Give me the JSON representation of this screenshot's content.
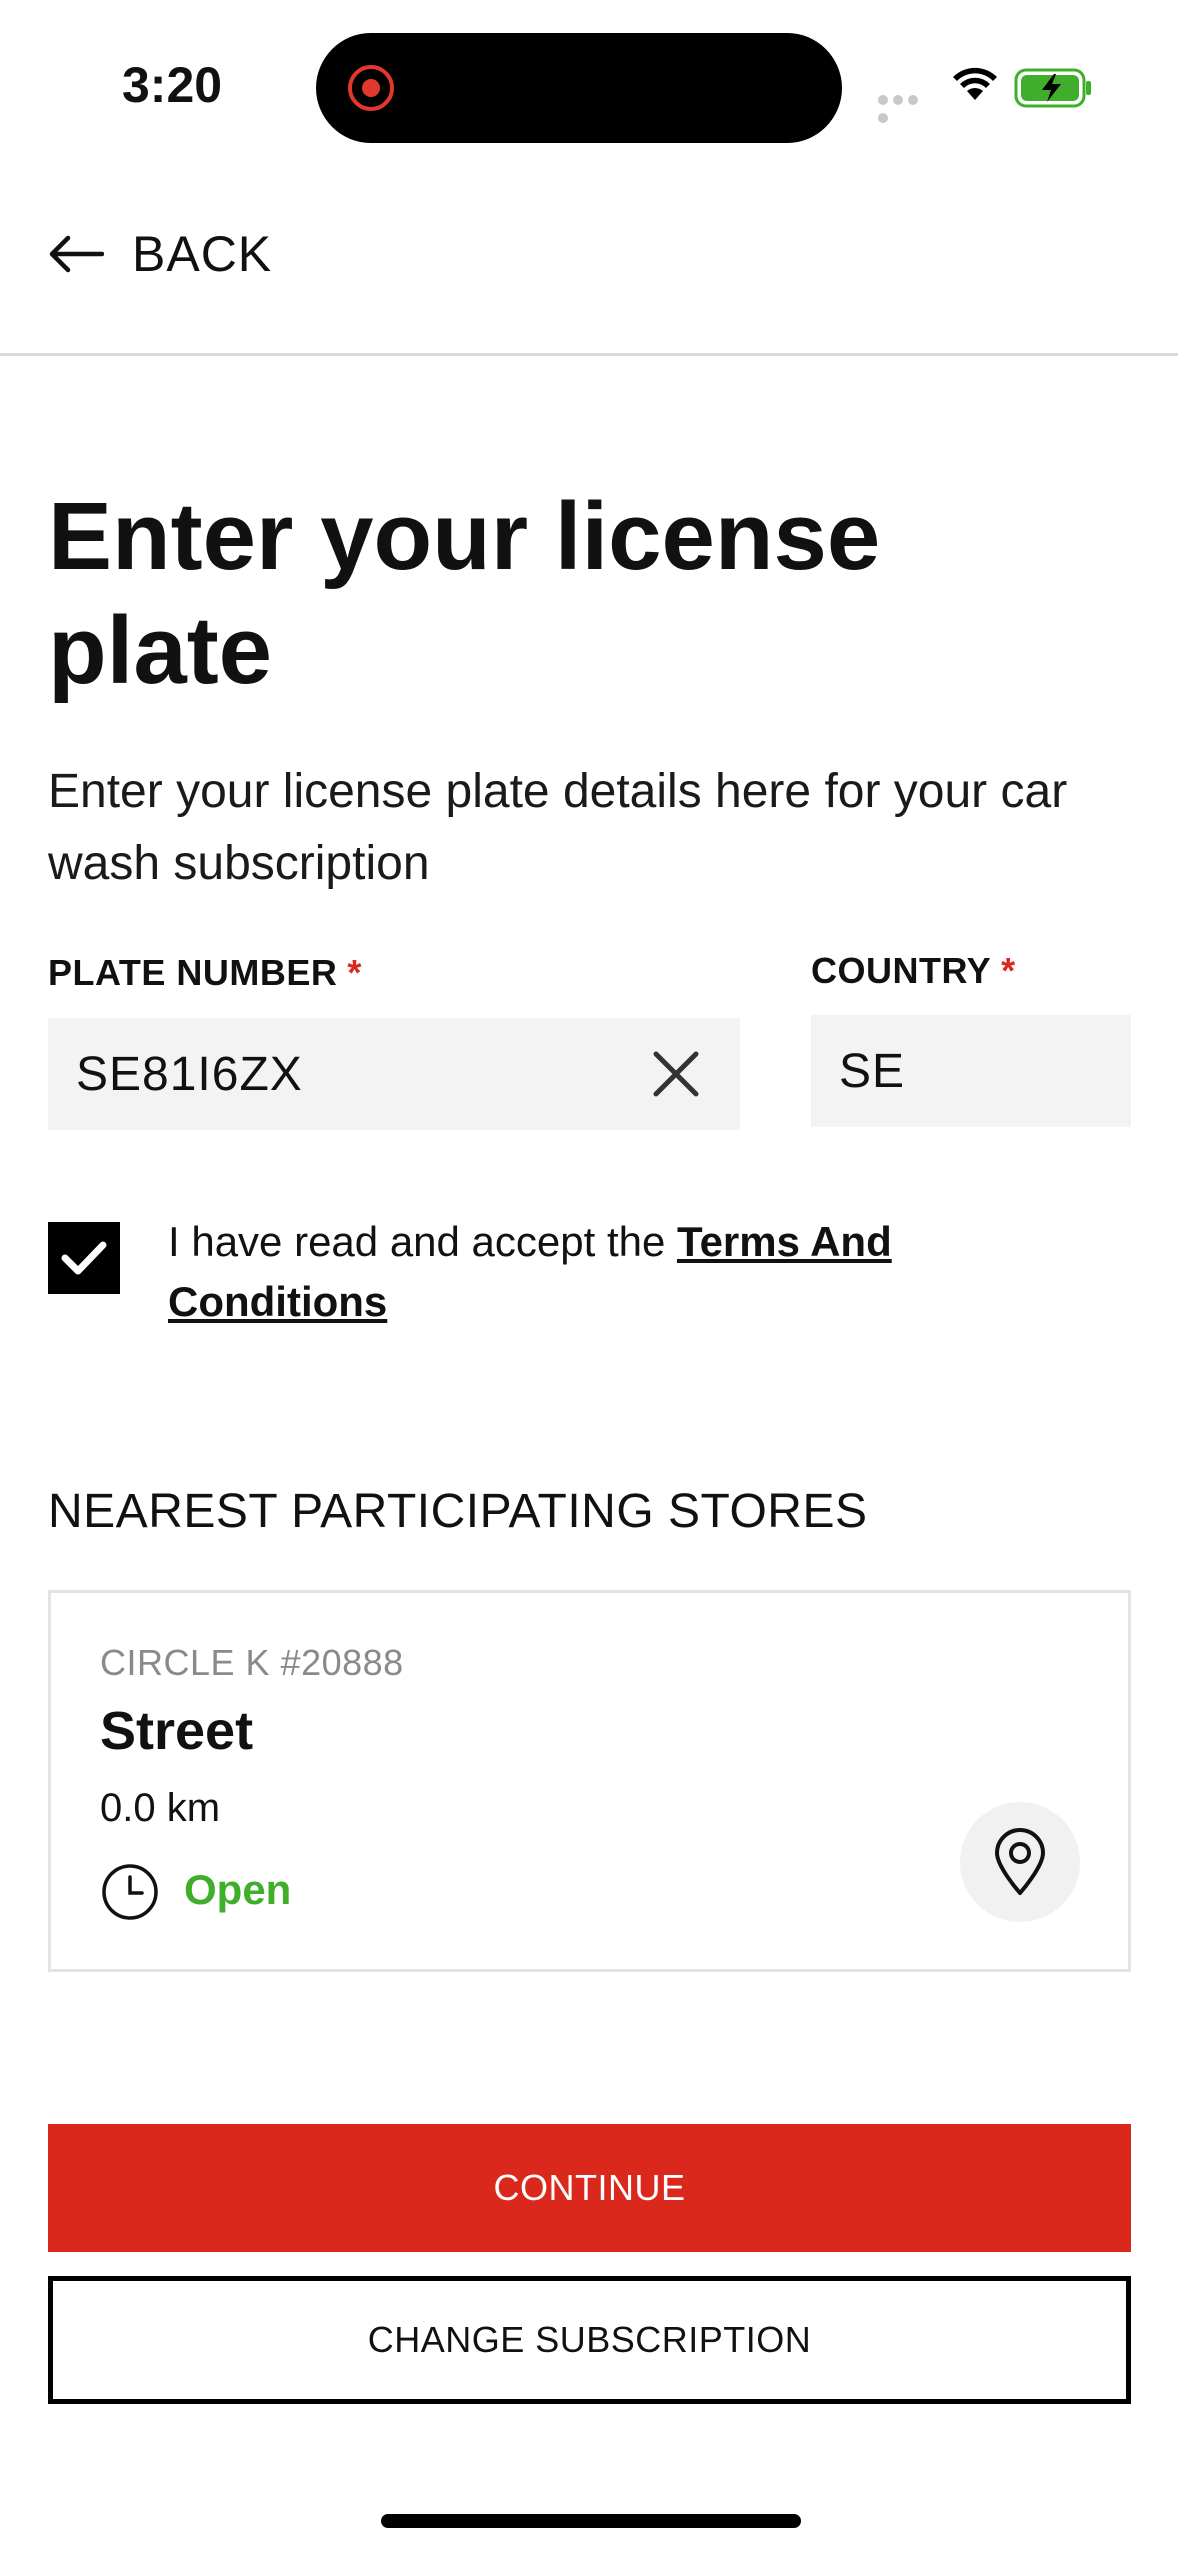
{
  "status_bar": {
    "time": "3:20",
    "icons": [
      "record-icon",
      "signal-dots-icon",
      "wifi-icon",
      "battery-charging-icon"
    ]
  },
  "nav": {
    "back_label": "BACK",
    "back_icon": "arrow-left-icon"
  },
  "page": {
    "title": "Enter your license plate",
    "description": "Enter your license plate details here for your car wash subscription"
  },
  "form": {
    "plate_label": "PLATE NUMBER",
    "plate_required_marker": "*",
    "plate_value": "SE81I6ZX",
    "country_label": "COUNTRY",
    "country_required_marker": "*",
    "country_value": "SE",
    "terms_checked": true,
    "terms_text": "I have read and accept the ",
    "terms_link": "Terms And Conditions"
  },
  "stores": {
    "section_title": "NEAREST PARTICIPATING STORES",
    "items": [
      {
        "store_id": "CIRCLE K #20888",
        "name": "Street",
        "distance": "0.0 km",
        "status": "Open"
      }
    ]
  },
  "actions": {
    "continue_label": "CONTINUE",
    "change_label": "CHANGE SUBSCRIPTION"
  },
  "colors": {
    "brand_red": "#da291c",
    "open_green": "#3fae2a"
  }
}
